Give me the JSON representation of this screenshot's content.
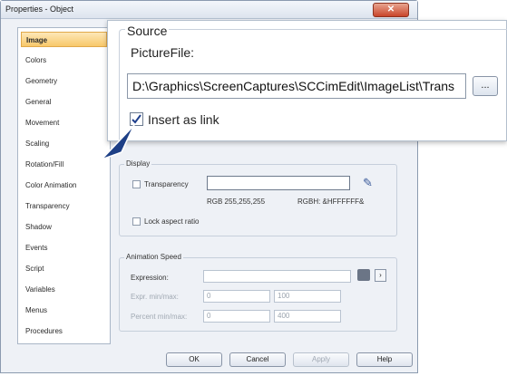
{
  "window": {
    "title": "Properties - Object",
    "close_glyph": "✕"
  },
  "sidebar": {
    "items": [
      {
        "label": "Image",
        "active": true
      },
      {
        "label": "Colors"
      },
      {
        "label": "Geometry"
      },
      {
        "label": "General"
      },
      {
        "label": "Movement"
      },
      {
        "label": "Scaling"
      },
      {
        "label": "Rotation/Fill"
      },
      {
        "label": "Color Animation"
      },
      {
        "label": "Transparency"
      },
      {
        "label": "Shadow"
      },
      {
        "label": "Events"
      },
      {
        "label": "Script"
      },
      {
        "label": "Variables"
      },
      {
        "label": "Menus"
      },
      {
        "label": "Procedures"
      }
    ]
  },
  "source": {
    "group_label": "Source",
    "picturefile_label": "PictureFile:",
    "path_value": "D:\\Graphics\\ScreenCaptures\\SCCimEdit\\ImageList\\Trans",
    "browse_label": "...",
    "insert_as_link_label": "Insert as link",
    "insert_as_link_checked": true
  },
  "display": {
    "group_label": "Display",
    "transparency_label": "Transparency",
    "transparency_checked": false,
    "rgb_text": "RGB 255,255,255",
    "rgbh_text": "RGBH: &HFFFFFF&",
    "lock_aspect_label": "Lock aspect ratio",
    "lock_aspect_checked": false,
    "eyedropper_icon": "eyedropper-icon"
  },
  "animation": {
    "group_label": "Animation Speed",
    "expression_label": "Expression:",
    "expression_value": "",
    "expr_minmax_label": "Expr. min/max:",
    "expr_min": "0",
    "expr_max": "100",
    "percent_minmax_label": "Percent min/max:",
    "percent_min": "0",
    "percent_max": "400"
  },
  "buttons": {
    "ok": "OK",
    "cancel": "Cancel",
    "apply": "Apply",
    "help": "Help"
  },
  "colors": {
    "accent": "#f8c86a",
    "close": "#c9452a",
    "arrow": "#1d3f86"
  }
}
